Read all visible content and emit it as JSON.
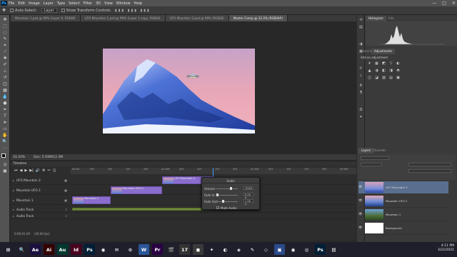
{
  "menubar": {
    "logo": "Ps",
    "items": [
      "File",
      "Edit",
      "Image",
      "Layer",
      "Type",
      "Select",
      "Filter",
      "3D",
      "View",
      "Window",
      "Help"
    ],
    "controls": [
      "—",
      "□",
      "✕"
    ]
  },
  "options": {
    "auto_select_label": "Auto-Select:",
    "auto_select_value": "Layer",
    "show_transform_label": "Show Transform Controls"
  },
  "tabs": [
    {
      "label": "Mountain 1.psd @ 99% (Layer 0, RGB/8)",
      "active": false
    },
    {
      "label": "UFO Mountain 1.psd @ 99% (Layer 1 copy, RGB/8)",
      "active": false
    },
    {
      "label": "UFO Mountain 2.psd @ 99% (RGB/8)",
      "active": false
    },
    {
      "label": "Master Comp @ 33.3% (RGB/8#)",
      "active": true
    }
  ],
  "status": {
    "zoom": "33.33%",
    "doc": "Doc: 5.93M/12.3M"
  },
  "timeline": {
    "title": "Timeline",
    "controls": [
      "⏮",
      "◀",
      "▶",
      "▶|",
      "🔊",
      "⚙",
      "✂",
      "◫"
    ],
    "ticks": [
      "00:00",
      "05f",
      "10f",
      "15f",
      "20f",
      "01:00f",
      "05f",
      "10f",
      "15f",
      "20f",
      "02:00f",
      "05f",
      "10f",
      "15f",
      "20f",
      "03:00f"
    ],
    "tracks": [
      {
        "label": "UFO Mountain 3",
        "clip": "UFO Mountain 3"
      },
      {
        "label": "Mountain UFO 2",
        "clip": "Mountain UFO 2"
      },
      {
        "label": "Mountain 1",
        "clip": "Mountain 1"
      },
      {
        "label": "Audio Track",
        "clip": ""
      },
      {
        "label": "Audio Track",
        "clip": ""
      }
    ],
    "current_time": "0:00:01:29",
    "fps": "(30.00 fps)"
  },
  "audio_popup": {
    "title": "Audio",
    "volume_label": "Volume:",
    "volume_value": "100%",
    "volume_level": 0.72,
    "fade_in_label": "Fade In:",
    "fade_in_value": "0.00 s",
    "fade_in_level": 0.0,
    "fade_out_label": "Fade Out:",
    "fade_out_value": "1.59 s",
    "fade_out_level": 0.28,
    "mute_label": "Mute Audio"
  },
  "panels": {
    "top_tabs": [
      "Histogram",
      "Info"
    ],
    "adj_tabs": [
      "Libraries",
      "Adjustments"
    ],
    "add_adjustment": "Add an adjustment",
    "adj_icons": [
      "☀",
      "▦",
      "◩",
      "▽",
      "◐",
      "▲",
      "◑",
      "◧",
      "◨",
      "◓",
      "◫",
      "◪",
      "▨",
      "▤",
      "▣"
    ],
    "layer_tabs": [
      "Layers",
      "Channels"
    ],
    "layers": [
      {
        "name": "UFO Mountain 3",
        "visible": true
      },
      {
        "name": "Mountain UFO 2",
        "visible": true
      },
      {
        "name": "Mountain 1",
        "visible": true
      },
      {
        "name": "Background",
        "visible": true
      }
    ]
  },
  "taskbar": {
    "apps": [
      {
        "label": "⊞",
        "color": "#1f1f2b"
      },
      {
        "label": "🔍",
        "color": "#1f1f2b"
      },
      {
        "label": "Ae",
        "color": "#1c0f40"
      },
      {
        "label": "Ai",
        "color": "#330000"
      },
      {
        "label": "Au",
        "color": "#00382f"
      },
      {
        "label": "Id",
        "color": "#49021f"
      },
      {
        "label": "Ps",
        "color": "#001e36"
      },
      {
        "label": "◉",
        "color": "#1f1f2b"
      },
      {
        "label": "✉",
        "color": "#1f1f2b"
      },
      {
        "label": "⊙",
        "color": "#1f1f2b"
      },
      {
        "label": "W",
        "color": "#2b579a"
      },
      {
        "label": "Pr",
        "color": "#2a0044"
      },
      {
        "label": "🎬",
        "color": "#1f1f2b"
      },
      {
        "label": "17",
        "color": "#333333"
      },
      {
        "label": "◼",
        "color": "#3a3a3a"
      },
      {
        "label": "✦",
        "color": "#1f1f2b"
      },
      {
        "label": "◐",
        "color": "#1f1f2b"
      },
      {
        "label": "◈",
        "color": "#1f1f2b"
      },
      {
        "label": "✎",
        "color": "#1f1f2b"
      },
      {
        "label": "◇",
        "color": "#1f1f2b"
      },
      {
        "label": "▣",
        "color": "#2a4a8a"
      },
      {
        "label": "◉",
        "color": "#1f1f2b"
      },
      {
        "label": "◎",
        "color": "#1f1f2b"
      },
      {
        "label": "Ps",
        "color": "#001e36"
      },
      {
        "label": "▤",
        "color": "#1f1f2b"
      }
    ],
    "time": "4:11 PM",
    "date": "3/22/2021"
  }
}
